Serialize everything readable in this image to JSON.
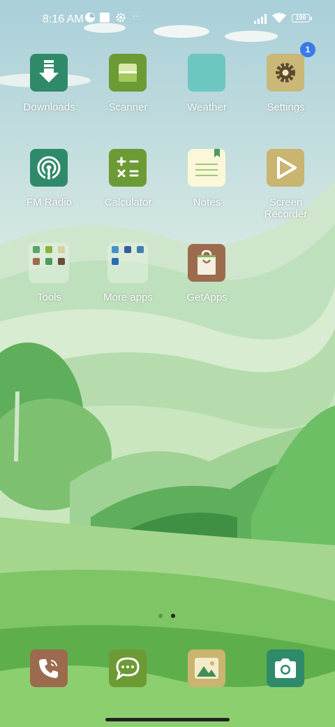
{
  "status_bar": {
    "time": "8:16 AM",
    "battery": "100",
    "icons": [
      "vpn-icon",
      "square-notification-icon",
      "gear-icon",
      "more-icon",
      "signal-icon",
      "wifi-icon",
      "battery-icon"
    ]
  },
  "apps": [
    {
      "label": "Downloads",
      "icon": "download-icon",
      "color": "#2f8a6a"
    },
    {
      "label": "Scanner",
      "icon": "scanner-icon",
      "color": "#6c9a35"
    },
    {
      "label": "Weather",
      "icon": "weather-icon",
      "color": "#6cc6c1"
    },
    {
      "label": "Settings",
      "icon": "settings-gear-icon",
      "color": "#c9b878",
      "badge": "1"
    },
    {
      "label": "FM Radio",
      "icon": "radio-icon",
      "color": "#2f8a6a"
    },
    {
      "label": "Calculator",
      "icon": "calculator-icon",
      "color": "#6c9a35"
    },
    {
      "label": "Notes",
      "icon": "notes-icon",
      "color": "#fbf7d8"
    },
    {
      "label": "Screen Recorder",
      "label_line1": "Screen",
      "label_line2": "Recorder",
      "icon": "screen-recorder-icon",
      "color": "#c9b470"
    },
    {
      "label": "Tools",
      "icon": "folder-icon"
    },
    {
      "label": "More apps",
      "icon": "folder-icon"
    },
    {
      "label": "GetApps",
      "icon": "getapps-bag-icon",
      "color": "#9c6b4e"
    }
  ],
  "dock": [
    {
      "icon": "phone-icon",
      "color": "#9c6b4e"
    },
    {
      "icon": "messages-icon",
      "color": "#6c9a35"
    },
    {
      "icon": "gallery-icon",
      "color": "#c9b470"
    },
    {
      "icon": "camera-icon",
      "color": "#2f8a6a"
    }
  ],
  "page_indicator": {
    "pages": 2,
    "current": 2
  }
}
